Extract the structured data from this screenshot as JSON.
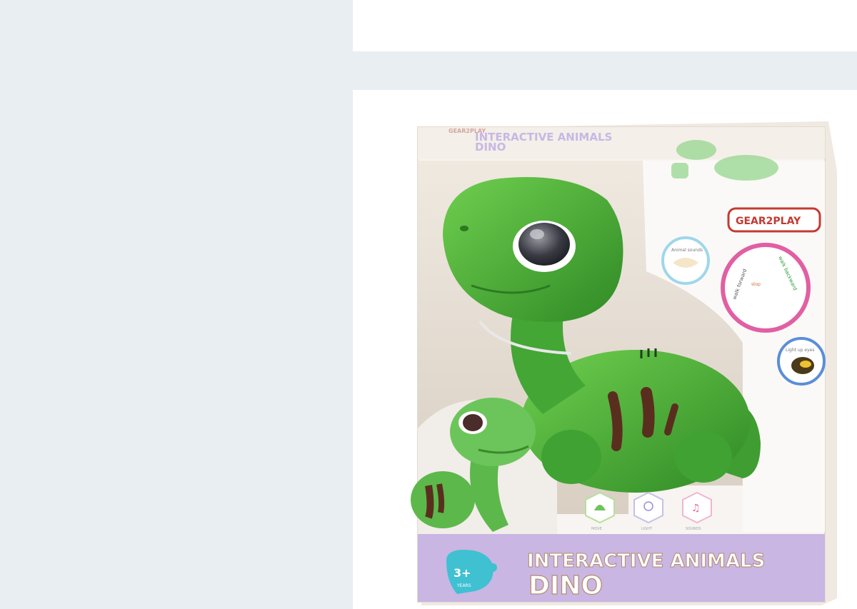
{
  "product": {
    "brand": "GEAR2PLAY",
    "top_title_line1": "INTERACTIVE ANIMALS",
    "top_title_line2": "DINO",
    "bottom_title_line1": "INTERACTIVE ANIMALS",
    "bottom_title_line2": "DINO",
    "age_badge": "3+",
    "age_badge_sub": "YEARS",
    "feature_circles": [
      "Animal sounds",
      "walk forward",
      "walk backward",
      "stop",
      "Light up eyes"
    ],
    "feature_icon_labels": [
      "MOVE",
      "LIGHT",
      "SOUNDS"
    ]
  },
  "colors": {
    "dino_green": "#4caf3a",
    "box_purple": "#c9b6e3",
    "box_white": "#f7f4f1"
  }
}
